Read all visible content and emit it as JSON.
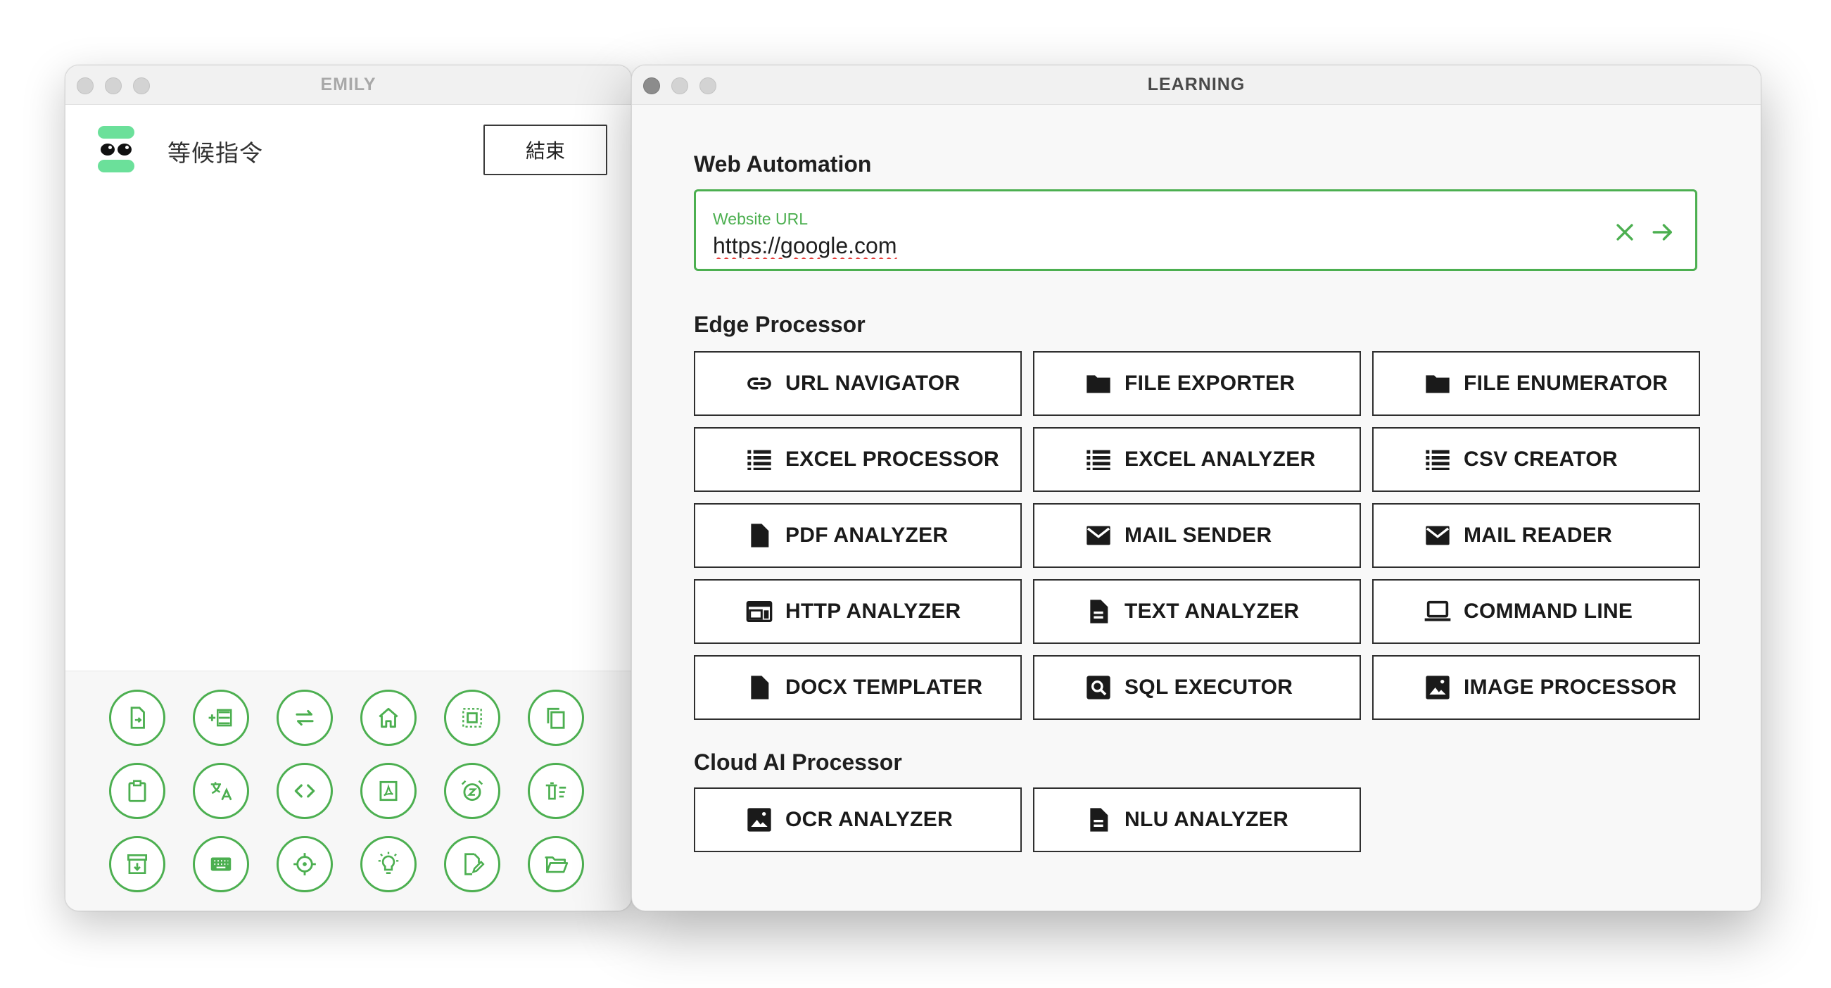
{
  "emily_window": {
    "title": "EMILY",
    "status": "等候指令",
    "end_button_label": "結束",
    "dock_icons": [
      {
        "name": "file-export-icon"
      },
      {
        "name": "list-add-icon"
      },
      {
        "name": "repeat-icon"
      },
      {
        "name": "home-icon"
      },
      {
        "name": "select-all-icon"
      },
      {
        "name": "copy-icon"
      },
      {
        "name": "clipboard-icon"
      },
      {
        "name": "translate-icon"
      },
      {
        "name": "code-icon"
      },
      {
        "name": "pdf-icon"
      },
      {
        "name": "snooze-alarm-icon"
      },
      {
        "name": "delete-sweep-icon"
      },
      {
        "name": "archive-icon"
      },
      {
        "name": "keyboard-icon"
      },
      {
        "name": "crosshair-icon"
      },
      {
        "name": "lightbulb-icon"
      },
      {
        "name": "edit-document-icon"
      },
      {
        "name": "folder-open-icon"
      }
    ]
  },
  "learning_window": {
    "title": "LEARNING",
    "web_automation": {
      "title": "Web Automation",
      "url_label": "Website URL",
      "url_value": "https://google.com"
    },
    "edge_processor": {
      "title": "Edge Processor",
      "buttons": [
        {
          "label": "URL NAVIGATOR",
          "icon": "link-icon"
        },
        {
          "label": "FILE EXPORTER",
          "icon": "folder-icon"
        },
        {
          "label": "FILE ENUMERATOR",
          "icon": "folder-icon"
        },
        {
          "label": "EXCEL PROCESSOR",
          "icon": "list-icon"
        },
        {
          "label": "EXCEL ANALYZER",
          "icon": "list-icon"
        },
        {
          "label": "CSV CREATOR",
          "icon": "list-icon"
        },
        {
          "label": "PDF ANALYZER",
          "icon": "file-icon"
        },
        {
          "label": "MAIL SENDER",
          "icon": "mail-icon"
        },
        {
          "label": "MAIL READER",
          "icon": "mail-icon"
        },
        {
          "label": "HTTP ANALYZER",
          "icon": "web-icon"
        },
        {
          "label": "TEXT ANALYZER",
          "icon": "document-text-icon"
        },
        {
          "label": "COMMAND LINE",
          "icon": "laptop-icon"
        },
        {
          "label": "DOCX TEMPLATER",
          "icon": "file-icon"
        },
        {
          "label": "SQL EXECUTOR",
          "icon": "search-box-icon"
        },
        {
          "label": "IMAGE PROCESSOR",
          "icon": "image-icon"
        }
      ]
    },
    "cloud_ai_processor": {
      "title": "Cloud AI Processor",
      "buttons": [
        {
          "label": "OCR ANALYZER",
          "icon": "image-icon"
        },
        {
          "label": "NLU ANALYZER",
          "icon": "document-text-icon"
        }
      ]
    }
  },
  "colors": {
    "accent_green": "#4caf50",
    "logo_green": "#6be09a",
    "spellcheck_red": "#e53935"
  }
}
